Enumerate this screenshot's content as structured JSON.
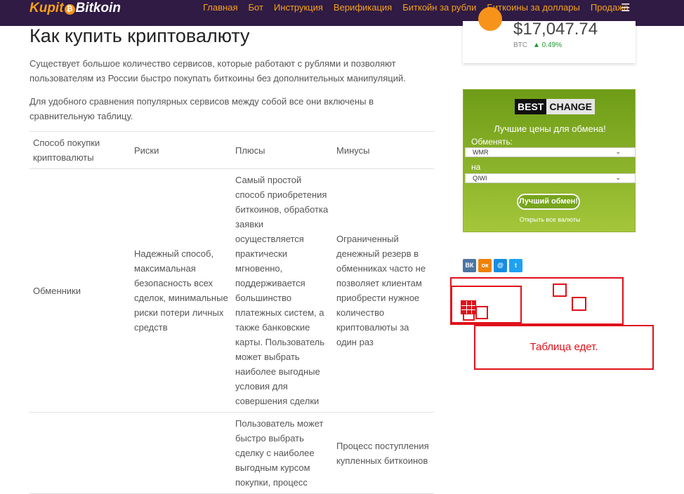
{
  "header": {
    "logo_left": "Kupit",
    "logo_coin": "₿",
    "logo_right": "Bitkoin",
    "nav": [
      "Главная",
      "Бот",
      "Инструкция",
      "Верификация",
      "Биткойн за рубли",
      "Биткоины за доллары",
      "Продажа"
    ],
    "menu_icon": "☰"
  },
  "article": {
    "title": "Как купить криптовалюту",
    "paragraph1": "Существует большое количество сервисов, которые работают с рублями и позволяют пользователям из России быстро покупать биткоины без дополнительных манипуляций.",
    "paragraph2": "Для удобного сравнения популярных сервисов между собой все они включены в сравнительную таблицу."
  },
  "table": {
    "headers": [
      "Способ покупки криптовалюты",
      "Риски",
      "Плюсы",
      "Минусы"
    ],
    "rows": [
      {
        "method": "Обменники",
        "risks": "Надежный способ, максимальная безопасность всех сделок, минимальные риски потери личных средств",
        "pros": "Самый простой способ приобретения биткоинов, обработка заявки осуществляется практически мгновенно, поддерживается большинство платежных систем, а также банковские карты. Пользователь может выбрать наиболее выгодные условия для совершения сделки",
        "cons": "Ограниченный денежный резерв в обменниках часто не позволяет клиентам приобрести нужное количество криптовалюты за один раз"
      },
      {
        "method": "",
        "risks": "",
        "pros": "Пользователь может быстро выбрать сделку с наиболее выгодным курсом покупки, процесс",
        "cons": "Процесс поступления купленных биткоинов"
      }
    ]
  },
  "price_widget": {
    "price": "$17,047.74",
    "ticker": "BTC",
    "change": "▲ 0.49%",
    "change_color": "#1a9a2a"
  },
  "bestchange": {
    "logo_a": "BEST",
    "logo_b": "CHANGE",
    "title": "Лучшие цены для обмена!",
    "from_label": "Обменять:",
    "from_value": "WMR",
    "to_label": "на",
    "to_value": "QIWI",
    "button": "Лучший обмен!",
    "link": "Открыть все валюты",
    "chevron": "⌄"
  },
  "share": [
    "ВК",
    "ок",
    "@",
    "t"
  ],
  "annotation": {
    "text": "Таблица едет.",
    "color": "#e0101a"
  }
}
